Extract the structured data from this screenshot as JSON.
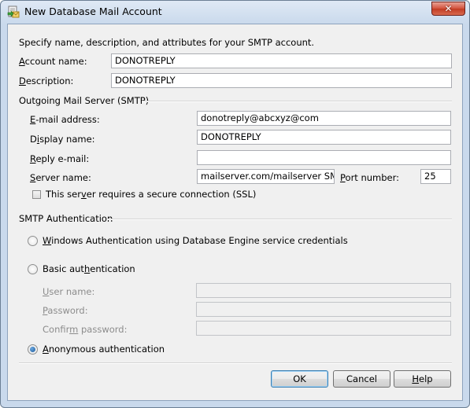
{
  "window": {
    "title": "New Database Mail Account",
    "close_glyph": "✕",
    "app_icon": "database-mail-icon"
  },
  "intro": "Specify name, description, and attributes for your SMTP account.",
  "account": {
    "name_label_pre": "",
    "name_label_key": "A",
    "name_label_post": "ccount name:",
    "name_value": "DONOTREPLY",
    "desc_label_pre": "",
    "desc_label_key": "D",
    "desc_label_post": "escription:",
    "desc_value": "DONOTREPLY"
  },
  "outgoing": {
    "group_label": "Outgoing Mail Server (SMTP)",
    "email_label_pre": "",
    "email_label_key": "E",
    "email_label_post": "-mail address:",
    "email_value": "donotreply@abcxyz@com",
    "display_label_pre": "D",
    "display_label_key": "i",
    "display_label_post": "splay name:",
    "display_value": "DONOTREPLY",
    "reply_label_pre": "",
    "reply_label_key": "R",
    "reply_label_post": "eply e-mail:",
    "reply_value": "",
    "server_label_pre": "",
    "server_label_key": "S",
    "server_label_post": "erver name:",
    "server_value": "mailserver.com/mailserver SMTP IP",
    "port_label_pre": "",
    "port_label_key": "P",
    "port_label_post": "ort number:",
    "port_value": "25",
    "ssl_label_pre": "This ser",
    "ssl_label_key": "v",
    "ssl_label_post": "er requires a secure connection (SSL)",
    "ssl_checked": false
  },
  "auth": {
    "group_label": "SMTP Authentication",
    "windows_pre": "",
    "windows_key": "W",
    "windows_post": "indows Authentication using Database Engine service credentials",
    "basic_pre": "Basic aut",
    "basic_key": "h",
    "basic_post": "entication",
    "user_pre": "",
    "user_key": "U",
    "user_post": "ser name:",
    "user_value": "",
    "password_pre": "",
    "password_key": "P",
    "password_post": "assword:",
    "password_value": "",
    "confirm_pre": "Confir",
    "confirm_key": "m",
    "confirm_post": " password:",
    "confirm_value": "",
    "anonymous_pre": "",
    "anonymous_key": "A",
    "anonymous_post": "nonymous authentication",
    "selected": "anonymous"
  },
  "buttons": {
    "ok": "OK",
    "cancel": "Cancel",
    "help_pre": "",
    "help_key": "H",
    "help_post": "elp"
  }
}
